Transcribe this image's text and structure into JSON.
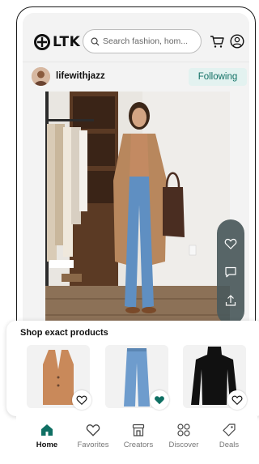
{
  "header": {
    "logo_text": "LTK",
    "search_placeholder": "Search fashion, hom..."
  },
  "creator": {
    "name": "lifewithjazz",
    "follow_label": "Following"
  },
  "shop": {
    "title": "Shop exact products",
    "products": [
      {
        "name": "camel coat",
        "favorited": false
      },
      {
        "name": "wide-leg jeans",
        "favorited": true
      },
      {
        "name": "black turtleneck",
        "favorited": false
      }
    ]
  },
  "nav": {
    "items": [
      {
        "label": "Home",
        "icon": "home-icon",
        "active": true
      },
      {
        "label": "Favorites",
        "icon": "heart-icon",
        "active": false
      },
      {
        "label": "Creators",
        "icon": "creators-icon",
        "active": false
      },
      {
        "label": "Discover",
        "icon": "discover-icon",
        "active": false
      },
      {
        "label": "Deals",
        "icon": "tag-icon",
        "active": false
      }
    ]
  },
  "colors": {
    "accent": "#0f6f63",
    "follow_bg": "#e3f2f0",
    "rail": "#4b5a5c"
  }
}
